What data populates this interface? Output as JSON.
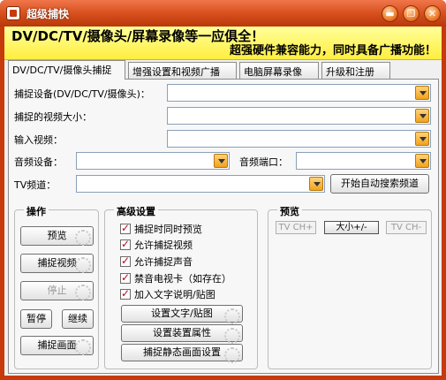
{
  "window": {
    "title": "超级捕快",
    "icon": "app-logo-icon",
    "controls": {
      "minimize": "▬",
      "maximize": "❐",
      "close": "✕"
    },
    "frame_color": "#c73a0c"
  },
  "slogan": {
    "line1": "DV/DC/TV/摄像头/屏幕录像等一应俱全！",
    "line2": "超强硬件兼容能力，同时具备广播功能！",
    "bg_color": "#ffee40"
  },
  "tabs": [
    {
      "label": "DV/DC/TV/摄像头捕捉",
      "active": true
    },
    {
      "label": "增强设置和视频广播",
      "active": false
    },
    {
      "label": "电脑屏幕录像",
      "active": false
    },
    {
      "label": "升级和注册",
      "active": false
    }
  ],
  "capture_form": {
    "device_label": "捕捉设备(DV/DC/TV/摄像头)：",
    "device_value": "",
    "size_label": "捕捉的视频大小：",
    "size_value": "",
    "input_label": "输入视频：",
    "input_value": "",
    "audio_device_label": "音频设备：",
    "audio_device_value": "",
    "audio_port_label": "音频端口：",
    "audio_port_value": "",
    "tv_channel_label": "TV频道：",
    "tv_channel_value": "",
    "auto_search_button": "开始自动搜索频道"
  },
  "operation": {
    "title": "操作",
    "preview": "预览",
    "capture_video": "捕捉视频",
    "stop": "停止",
    "pause": "暂停",
    "resume": "继续",
    "capture_frame": "捕捉画面"
  },
  "advanced": {
    "title": "高级设置",
    "options": [
      {
        "label": "捕捉时同时预览",
        "checked": true
      },
      {
        "label": "允许捕捉视频",
        "checked": true
      },
      {
        "label": "允许捕捉声音",
        "checked": true
      },
      {
        "label": "禁音电视卡（如存在）",
        "checked": true
      },
      {
        "label": "加入文字说明/贴图",
        "checked": true
      }
    ],
    "set_text_button": "设置文字/贴图",
    "device_props_button": "设置装置属性",
    "still_settings_button": "捕捉静态画面设置"
  },
  "preview": {
    "title": "预览",
    "tv_ch_plus": "TV CH+",
    "size_toggle": "大小+/-",
    "tv_ch_minus": "TV CH-"
  }
}
